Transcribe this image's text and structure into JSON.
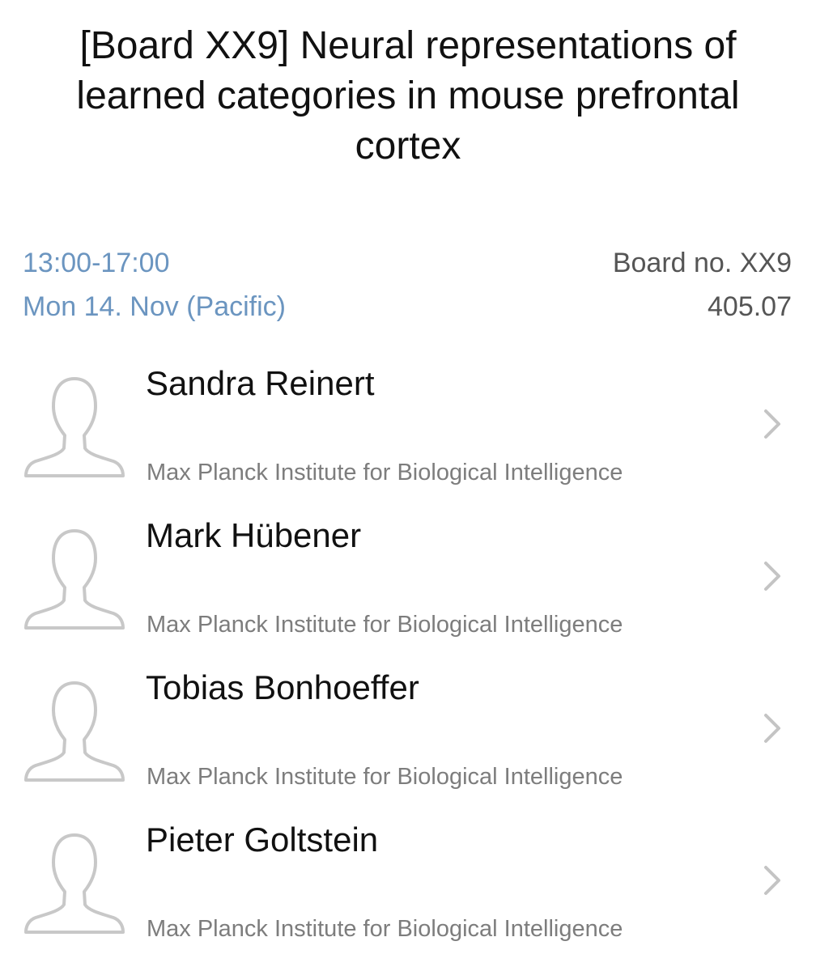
{
  "title": "[Board XX9] Neural representations of learned categories in mouse prefrontal cortex",
  "time": "13:00-17:00",
  "date": "Mon 14. Nov (Pacific)",
  "board": "Board no. XX9",
  "code": "405.07",
  "colors": {
    "accent": "#6b95c0",
    "secondary_text": "#7d7d7d",
    "icon": "#c8c8c8"
  },
  "authors": [
    {
      "name": "Sandra Reinert",
      "affiliation": "Max Planck Institute for Biological Intelligence",
      "icon": "person-placeholder-icon"
    },
    {
      "name": "Mark Hübener",
      "affiliation": "Max Planck Institute for Biological Intelligence",
      "icon": "person-placeholder-icon"
    },
    {
      "name": "Tobias Bonhoeffer",
      "affiliation": "Max Planck Institute for Biological Intelligence",
      "icon": "person-placeholder-icon"
    },
    {
      "name": "Pieter Goltstein",
      "affiliation": "Max Planck Institute for Biological Intelligence",
      "icon": "person-placeholder-icon"
    }
  ]
}
